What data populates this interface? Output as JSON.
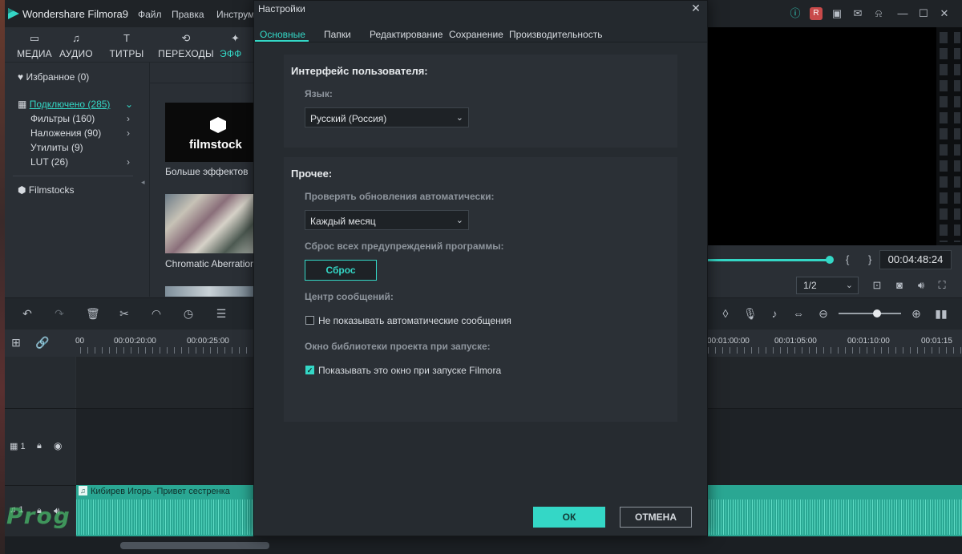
{
  "app": {
    "title": "Wondershare Filmora9",
    "menu": [
      "Файл",
      "Правка",
      "Инструм"
    ]
  },
  "library_tabs": [
    {
      "label": "МЕДИА",
      "icon": "folder-icon"
    },
    {
      "label": "АУДИО",
      "icon": "music-note-icon"
    },
    {
      "label": "ТИТРЫ",
      "icon": "text-icon"
    },
    {
      "label": "ПЕРЕХОДЫ",
      "icon": "transition-icon"
    },
    {
      "label": "ЭФФ",
      "icon": "effects-icon"
    }
  ],
  "tree": {
    "favorites": "Избранное (0)",
    "connected": "Подключено (285)",
    "filters": "Фильтры (160)",
    "overlays": "Наложения (90)",
    "utilities": "Утилиты (9)",
    "lut": "LUT (26)",
    "filmstocks": "Filmstocks"
  },
  "effects": {
    "filmstock_logo": "filmstock",
    "more_effects": "Больше эффектов",
    "chromatic": "Chromatic Aberration"
  },
  "timeline": {
    "ruler": [
      "00",
      "00:00:20:00",
      "00:00:25:00",
      "00:01:00:00",
      "00:01:05:00",
      "00:01:10:00",
      "00:01:15"
    ],
    "video_track": "1",
    "audio_track": "1",
    "audio_clip": "Кибирев Игорь -Привет сестренка"
  },
  "preview": {
    "timecode": "00:04:48:24",
    "ratio": "1/2",
    "progress": 0.54
  },
  "watermark": "Prog",
  "dialog": {
    "title": "Настройки",
    "tabs": [
      "Основные",
      "Папки",
      "Редактирование",
      "Сохранение",
      "Производительность"
    ],
    "ui_section": "Интерфейс пользователя:",
    "language_label": "Язык:",
    "language_value": "Русский (Россия)",
    "other_section": "Прочее:",
    "updates_label": "Проверять обновления автоматически:",
    "updates_value": "Каждый месяц",
    "reset_label": "Сброс всех предупреждений программы:",
    "reset_button": "Сброс",
    "msg_center_label": "Центр сообщений:",
    "msg_center_checkbox": "Не показывать автоматические сообщения",
    "msg_center_checked": false,
    "library_label": "Окно библиотеки проекта при запуске:",
    "library_checkbox": "Показывать это окно при запуске Filmora",
    "library_checked": true,
    "ok": "ОК",
    "cancel": "ОТМЕНА"
  },
  "colors": {
    "accent": "#34d7c6",
    "panel": "#2b3036",
    "audio_clip": "#2aa793"
  }
}
